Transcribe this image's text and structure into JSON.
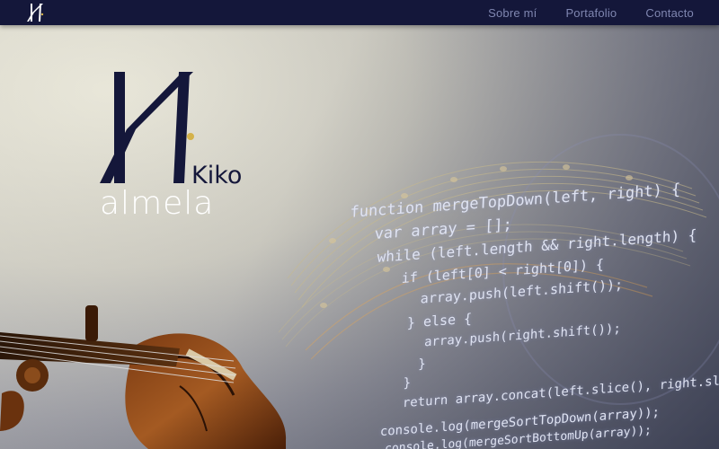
{
  "nav": {
    "links": [
      "Sobre mí",
      "Portafolio",
      "Contacto"
    ]
  },
  "brand": {
    "name_top": "Kiko",
    "name_bottom": "almela"
  },
  "code": {
    "lines": [
      "function mergeTopDown(left, right) {",
      "  var array = [];",
      "  while (left.length && right.length) {",
      "    if (left[0] < right[0]) {",
      "      array.push(left.shift());",
      "    } else {",
      "      array.push(right.shift());",
      "    }",
      "  }",
      "  return array.concat(left.slice(), right.slice());",
      "console.log(mergeSortTopDown(array));",
      "console.log(mergeSortBottomUp(array));"
    ]
  },
  "colors": {
    "navbar": "#14173a",
    "nav_link": "#7f86b0",
    "brand_dark": "#14173a",
    "brand_accent": "#d4b24a",
    "code_text": "#dfe3f2"
  }
}
